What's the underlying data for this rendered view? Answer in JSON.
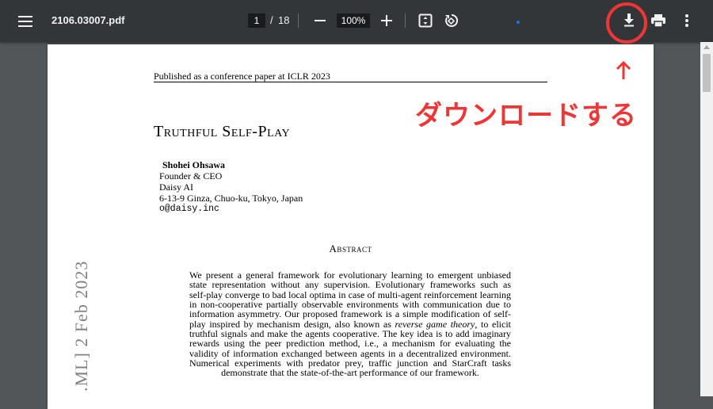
{
  "toolbar": {
    "file_name": "2106.03007.pdf",
    "current_page": "1",
    "page_separator": "/",
    "total_pages": "18",
    "zoom_level": "100%",
    "icons": {
      "menu": "hamburger-menu-icon",
      "zoom_out": "minus-icon",
      "zoom_in": "plus-icon",
      "fit": "fit-to-page-icon",
      "rotate": "rotate-icon",
      "download": "download-icon",
      "print": "print-icon",
      "more": "more-vertical-icon"
    }
  },
  "annotation": {
    "arrow": "↑",
    "text": "ダウンロードする",
    "color": "#ee3636"
  },
  "document": {
    "running_header": "Published as a conference paper at ICLR 2023",
    "title": "Truthful Self-Play",
    "author": {
      "name": "Shohei Ohsawa",
      "role": "Founder & CEO",
      "org": "Daisy AI",
      "address": "6-13-9 Ginza, Chuo-ku, Tokyo, Japan",
      "email": "o@daisy.inc"
    },
    "abstract_heading": "Abstract",
    "abstract_lines": [
      "We present a general framework for evolutionary learning to emergent unbiased",
      "state representation without any supervision. Evolutionary frameworks such as",
      "self-play converge to bad local optima in case of multi-agent reinforcement learning",
      "in non-cooperative partially observable environments with communication due to",
      "information asymmetry. Our proposed framework is a simple modification of self-",
      "play inspired by mechanism design, also known as",
      "reverse game theory",
      ", to elicit",
      "truthful signals and make the agents cooperative. The key idea is to add imaginary",
      "rewards using the peer prediction method, i.e., a mechanism for evaluating the",
      "validity of information exchanged between agents in a decentralized environment.",
      "Numerical experiments with predator prey, traffic junction and StarCraft tasks",
      "demonstrate that the state-of-the-art performance of our framework."
    ],
    "arxiv_stamp": ".ML]  2 Feb 2023"
  },
  "colors": {
    "toolbar_bg": "#323639",
    "viewer_bg": "#525659",
    "annotation_red": "#ee3636"
  }
}
